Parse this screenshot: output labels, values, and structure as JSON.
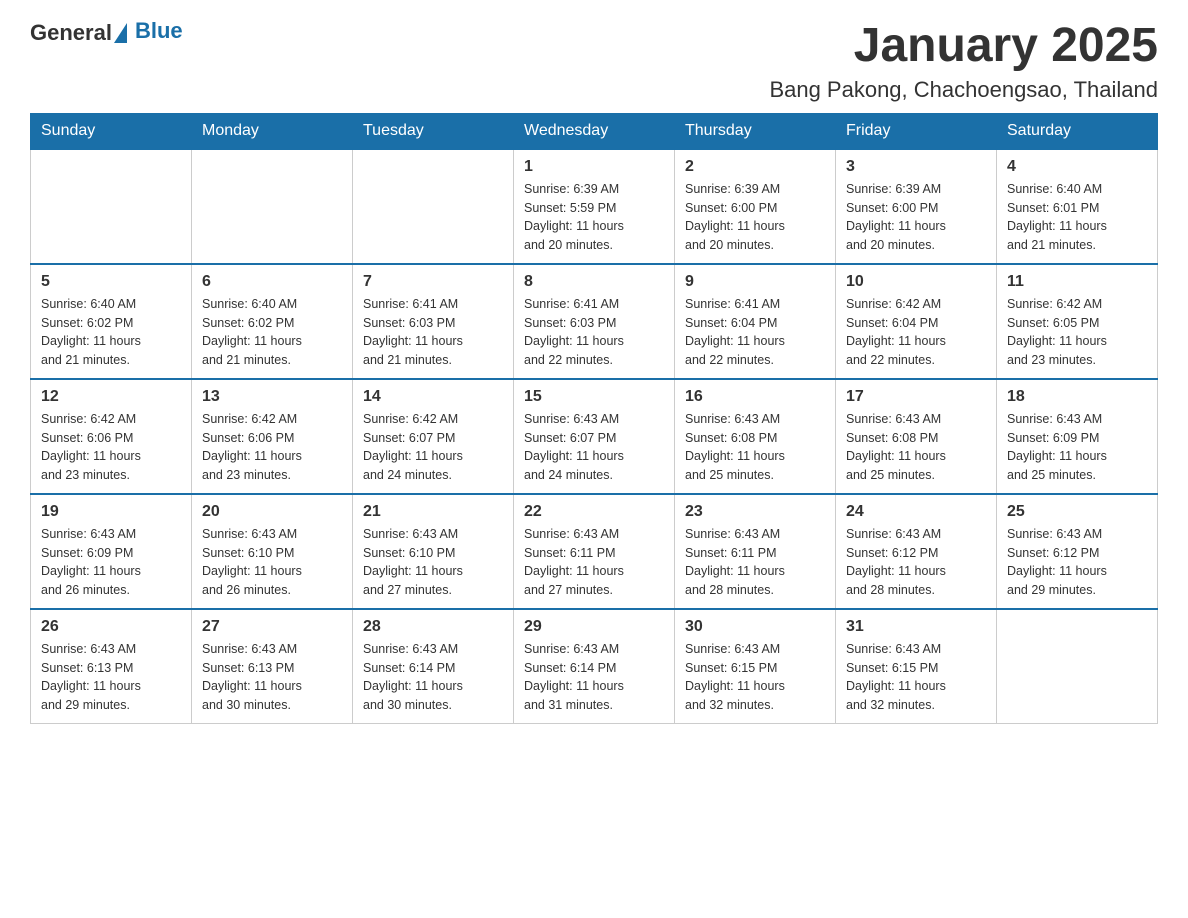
{
  "header": {
    "logo": {
      "general": "General",
      "blue": "Blue"
    },
    "title": "January 2025",
    "subtitle": "Bang Pakong, Chachoengsao, Thailand"
  },
  "calendar": {
    "days_of_week": [
      "Sunday",
      "Monday",
      "Tuesday",
      "Wednesday",
      "Thursday",
      "Friday",
      "Saturday"
    ],
    "weeks": [
      [
        {
          "day": "",
          "info": ""
        },
        {
          "day": "",
          "info": ""
        },
        {
          "day": "",
          "info": ""
        },
        {
          "day": "1",
          "info": "Sunrise: 6:39 AM\nSunset: 5:59 PM\nDaylight: 11 hours\nand 20 minutes."
        },
        {
          "day": "2",
          "info": "Sunrise: 6:39 AM\nSunset: 6:00 PM\nDaylight: 11 hours\nand 20 minutes."
        },
        {
          "day": "3",
          "info": "Sunrise: 6:39 AM\nSunset: 6:00 PM\nDaylight: 11 hours\nand 20 minutes."
        },
        {
          "day": "4",
          "info": "Sunrise: 6:40 AM\nSunset: 6:01 PM\nDaylight: 11 hours\nand 21 minutes."
        }
      ],
      [
        {
          "day": "5",
          "info": "Sunrise: 6:40 AM\nSunset: 6:02 PM\nDaylight: 11 hours\nand 21 minutes."
        },
        {
          "day": "6",
          "info": "Sunrise: 6:40 AM\nSunset: 6:02 PM\nDaylight: 11 hours\nand 21 minutes."
        },
        {
          "day": "7",
          "info": "Sunrise: 6:41 AM\nSunset: 6:03 PM\nDaylight: 11 hours\nand 21 minutes."
        },
        {
          "day": "8",
          "info": "Sunrise: 6:41 AM\nSunset: 6:03 PM\nDaylight: 11 hours\nand 22 minutes."
        },
        {
          "day": "9",
          "info": "Sunrise: 6:41 AM\nSunset: 6:04 PM\nDaylight: 11 hours\nand 22 minutes."
        },
        {
          "day": "10",
          "info": "Sunrise: 6:42 AM\nSunset: 6:04 PM\nDaylight: 11 hours\nand 22 minutes."
        },
        {
          "day": "11",
          "info": "Sunrise: 6:42 AM\nSunset: 6:05 PM\nDaylight: 11 hours\nand 23 minutes."
        }
      ],
      [
        {
          "day": "12",
          "info": "Sunrise: 6:42 AM\nSunset: 6:06 PM\nDaylight: 11 hours\nand 23 minutes."
        },
        {
          "day": "13",
          "info": "Sunrise: 6:42 AM\nSunset: 6:06 PM\nDaylight: 11 hours\nand 23 minutes."
        },
        {
          "day": "14",
          "info": "Sunrise: 6:42 AM\nSunset: 6:07 PM\nDaylight: 11 hours\nand 24 minutes."
        },
        {
          "day": "15",
          "info": "Sunrise: 6:43 AM\nSunset: 6:07 PM\nDaylight: 11 hours\nand 24 minutes."
        },
        {
          "day": "16",
          "info": "Sunrise: 6:43 AM\nSunset: 6:08 PM\nDaylight: 11 hours\nand 25 minutes."
        },
        {
          "day": "17",
          "info": "Sunrise: 6:43 AM\nSunset: 6:08 PM\nDaylight: 11 hours\nand 25 minutes."
        },
        {
          "day": "18",
          "info": "Sunrise: 6:43 AM\nSunset: 6:09 PM\nDaylight: 11 hours\nand 25 minutes."
        }
      ],
      [
        {
          "day": "19",
          "info": "Sunrise: 6:43 AM\nSunset: 6:09 PM\nDaylight: 11 hours\nand 26 minutes."
        },
        {
          "day": "20",
          "info": "Sunrise: 6:43 AM\nSunset: 6:10 PM\nDaylight: 11 hours\nand 26 minutes."
        },
        {
          "day": "21",
          "info": "Sunrise: 6:43 AM\nSunset: 6:10 PM\nDaylight: 11 hours\nand 27 minutes."
        },
        {
          "day": "22",
          "info": "Sunrise: 6:43 AM\nSunset: 6:11 PM\nDaylight: 11 hours\nand 27 minutes."
        },
        {
          "day": "23",
          "info": "Sunrise: 6:43 AM\nSunset: 6:11 PM\nDaylight: 11 hours\nand 28 minutes."
        },
        {
          "day": "24",
          "info": "Sunrise: 6:43 AM\nSunset: 6:12 PM\nDaylight: 11 hours\nand 28 minutes."
        },
        {
          "day": "25",
          "info": "Sunrise: 6:43 AM\nSunset: 6:12 PM\nDaylight: 11 hours\nand 29 minutes."
        }
      ],
      [
        {
          "day": "26",
          "info": "Sunrise: 6:43 AM\nSunset: 6:13 PM\nDaylight: 11 hours\nand 29 minutes."
        },
        {
          "day": "27",
          "info": "Sunrise: 6:43 AM\nSunset: 6:13 PM\nDaylight: 11 hours\nand 30 minutes."
        },
        {
          "day": "28",
          "info": "Sunrise: 6:43 AM\nSunset: 6:14 PM\nDaylight: 11 hours\nand 30 minutes."
        },
        {
          "day": "29",
          "info": "Sunrise: 6:43 AM\nSunset: 6:14 PM\nDaylight: 11 hours\nand 31 minutes."
        },
        {
          "day": "30",
          "info": "Sunrise: 6:43 AM\nSunset: 6:15 PM\nDaylight: 11 hours\nand 32 minutes."
        },
        {
          "day": "31",
          "info": "Sunrise: 6:43 AM\nSunset: 6:15 PM\nDaylight: 11 hours\nand 32 minutes."
        },
        {
          "day": "",
          "info": ""
        }
      ]
    ]
  }
}
